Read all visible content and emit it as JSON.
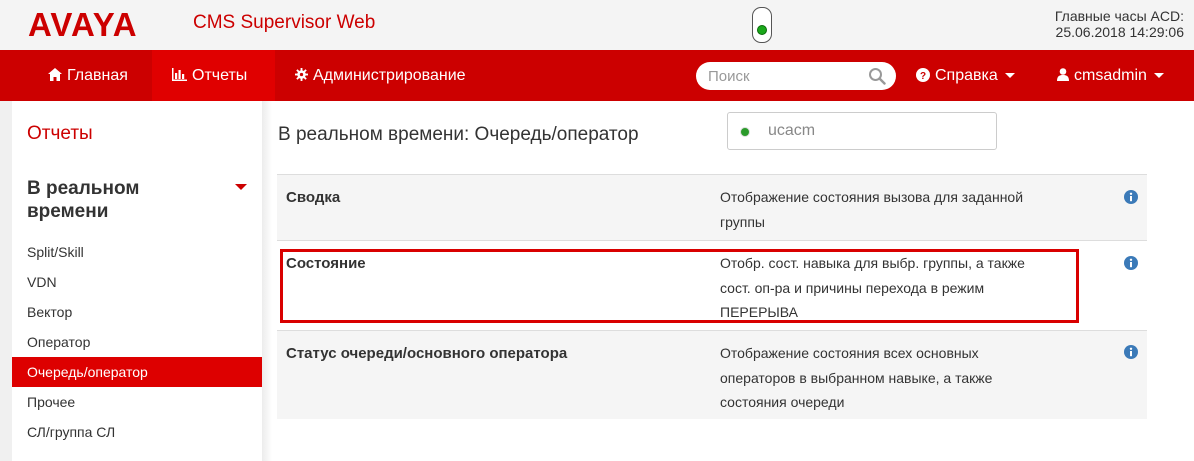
{
  "header": {
    "logo": "AVAYA",
    "app_title": "CMS Supervisor Web",
    "clock_label": "Главные часы ACD:",
    "clock_value": "25.06.2018 14:29:06"
  },
  "nav": {
    "home": "Главная",
    "reports": "Отчеты",
    "admin": "Администрирование",
    "search_placeholder": "Поиск",
    "help": "Справка",
    "user": "cmsadmin"
  },
  "sidebar": {
    "title": "Отчеты",
    "section": "В реальном времени",
    "items": [
      {
        "label": "Split/Skill"
      },
      {
        "label": "VDN"
      },
      {
        "label": "Вектор"
      },
      {
        "label": "Оператор"
      },
      {
        "label": "Очередь/оператор"
      },
      {
        "label": "Прочее"
      },
      {
        "label": "СЛ/группа СЛ"
      }
    ]
  },
  "main": {
    "title": "В реальном времени: Очередь/оператор",
    "server": "ucacm",
    "rows": [
      {
        "name": "Сводка",
        "desc_lines": [
          "Отображение состояния вызова для заданной",
          "группы"
        ]
      },
      {
        "name": "Состояние",
        "desc_lines": [
          "Отобр. сост. навыка для выбр. группы, а также",
          "сост. оп-ра и причины перехода в режим",
          "ПЕРЕРЫВА"
        ]
      },
      {
        "name": "Статус очереди/основного оператора",
        "desc_lines": [
          "Отображение состояния всех основных",
          "операторов в выбранном навыке, а также",
          "состояния очереди"
        ]
      }
    ]
  },
  "colors": {
    "brand_red": "#cc0000",
    "active_red": "#e00000",
    "info_blue": "#3b7ab8",
    "status_green": "#1aa81a"
  }
}
